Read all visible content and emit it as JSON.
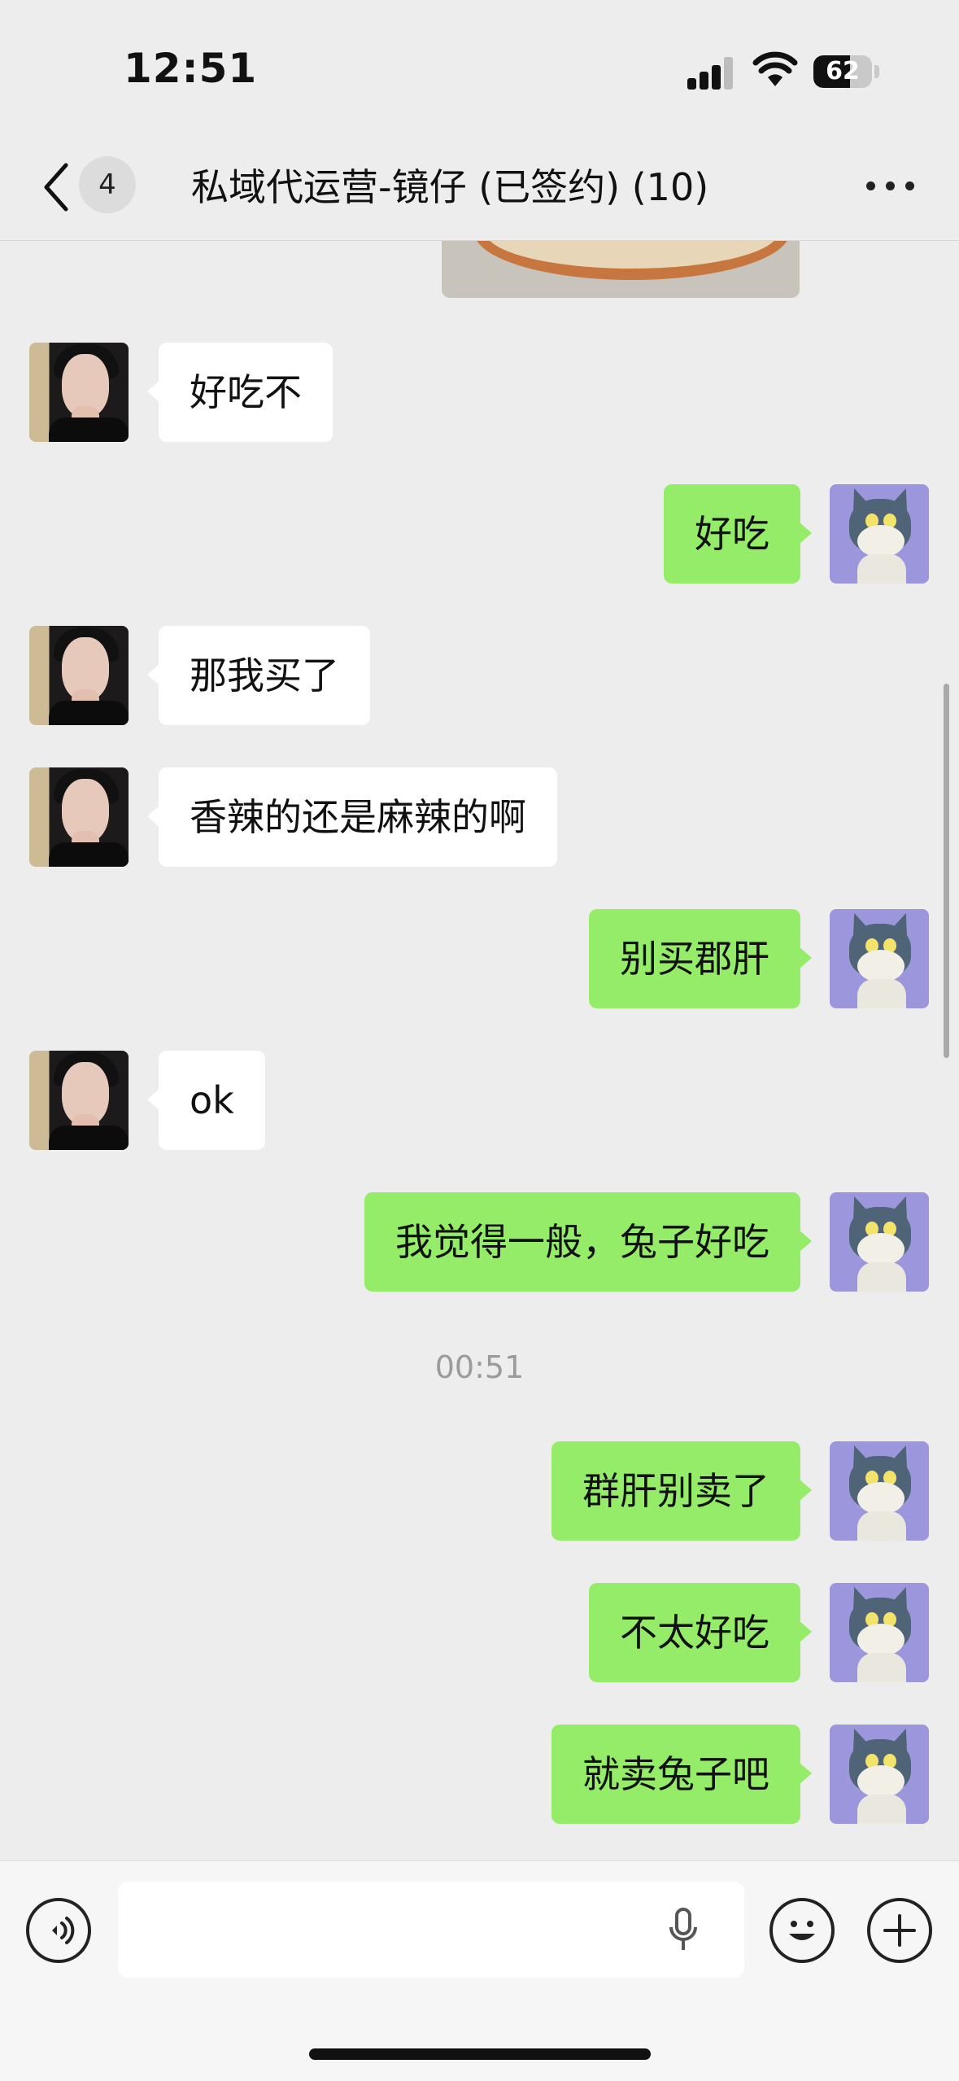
{
  "status_bar": {
    "time": "12:51",
    "battery": "62",
    "battery_level": 0.62
  },
  "nav": {
    "back_count": "4",
    "title": "私域代运营-镜仔 (已签约) (10)"
  },
  "messages": [
    {
      "side": "in",
      "text": "好吃不"
    },
    {
      "side": "out",
      "text": "好吃"
    },
    {
      "side": "in",
      "text": "那我买了"
    },
    {
      "side": "in",
      "text": "香辣的还是麻辣的啊"
    },
    {
      "side": "out",
      "text": "别买郡肝"
    },
    {
      "side": "in",
      "text": "ok"
    },
    {
      "side": "out",
      "text": "我觉得一般，兔子好吃"
    },
    {
      "side": "out",
      "text": "群肝别卖了"
    },
    {
      "side": "out",
      "text": "不太好吃"
    },
    {
      "side": "out",
      "text": "就卖兔子吧"
    }
  ],
  "timestamp": "00:51",
  "colors": {
    "outgoing_bubble": "#95ec69",
    "incoming_bubble": "#ffffff",
    "background": "#ededed"
  },
  "icons": {
    "back": "chevron-left-icon",
    "more": "more-dots-icon",
    "voice": "voice-icon",
    "mic": "microphone-icon",
    "emoji": "emoji-icon",
    "plus": "plus-icon"
  }
}
